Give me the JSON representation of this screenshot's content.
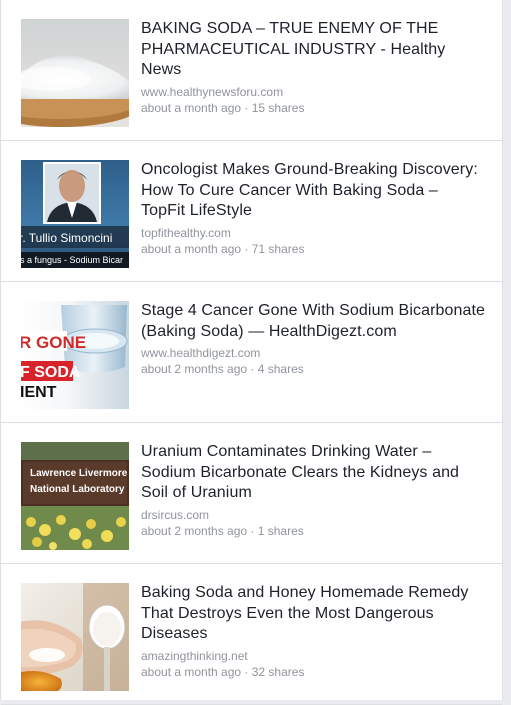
{
  "articles": [
    {
      "title": "BAKING SODA – TRUE ENEMY OF THE PHARMACEUTICAL INDUSTRY - Healthy News",
      "domain": "www.healthynewsforu.com",
      "time": "about a month ago",
      "shares": "15 shares",
      "thumbnail_icon": "baking-soda-spoon-icon"
    },
    {
      "title": "Oncologist Makes Ground-Breaking Discovery: How To Cure Cancer With Baking Soda – TopFit LifeStyle",
      "domain": "topfithealthy.com",
      "time": "about a month ago",
      "shares": "71 shares",
      "thumbnail_icon": "doctor-portrait-icon",
      "thumbnail_text": [
        "r. Tullio Simoncini",
        "s a fungus - Sodium Bicar"
      ]
    },
    {
      "title": "Stage 4 Cancer Gone With Sodium Bicarbonate (Baking Soda) — HealthDigezt.com",
      "domain": "www.healthdigezt.com",
      "time": "about 2 months ago",
      "shares": "4 shares",
      "thumbnail_icon": "glass-of-water-icon",
      "thumbnail_text": [
        "R GONE",
        "F SODA",
        "IENT"
      ]
    },
    {
      "title": "Uranium Contaminates Drinking Water – Sodium Bicarbonate Clears the Kidneys and Soil of Uranium",
      "domain": "drsircus.com",
      "time": "about 2 months ago",
      "shares": "1 shares",
      "thumbnail_icon": "laboratory-sign-icon",
      "thumbnail_text": [
        "Lawrence Livermore",
        "National Laboratory"
      ]
    },
    {
      "title": "Baking Soda and Honey Homemade Remedy That Destroys Even the Most Dangerous Diseases",
      "domain": "amazingthinking.net",
      "time": "about a month ago",
      "shares": "32 shares",
      "thumbnail_icon": "honey-spoon-icon"
    }
  ],
  "meta_separator": " · ",
  "colors": {
    "title": "#1d2129",
    "secondary": "#90949c",
    "divider": "#dddfe2",
    "background": "#e9ebee"
  }
}
